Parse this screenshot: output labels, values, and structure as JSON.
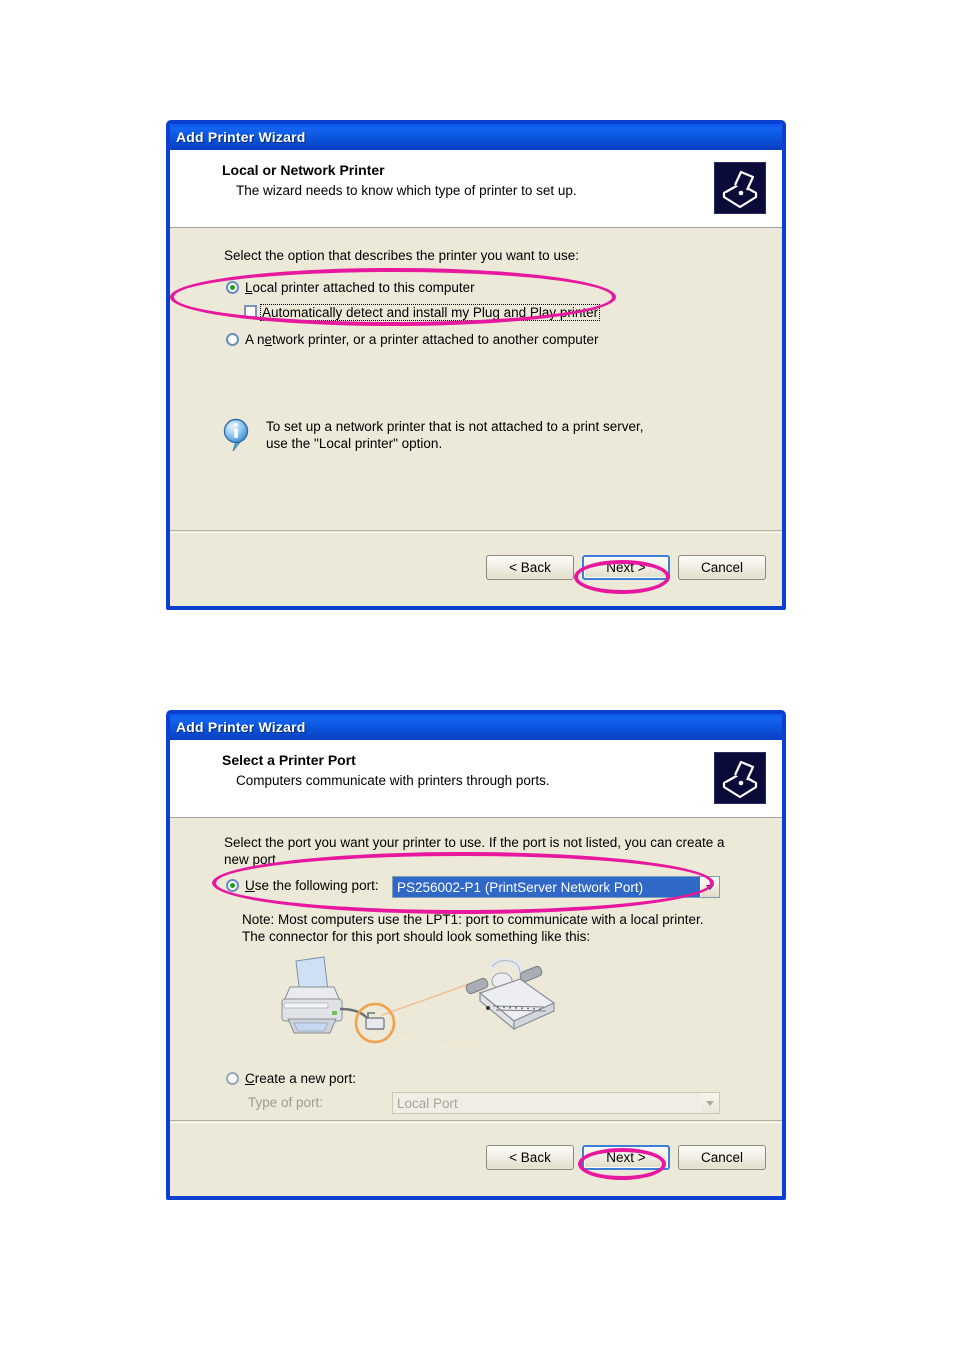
{
  "page": {
    "background": "#ffffff",
    "highlight_color": "#e8189e"
  },
  "dialogs": [
    {
      "id": "local-or-network-printer",
      "titlebar": "Add Printer Wizard",
      "header": {
        "title": "Local or Network Printer",
        "subtitle": "The wizard needs to know which type of printer to set up.",
        "icon": "printer-icon"
      },
      "body": {
        "instruction": "Select the option that describes the printer you want to use:",
        "radio_local": {
          "label": "Local printer attached to this computer",
          "accelerator": "L",
          "checked": true
        },
        "checkbox_autodetect": {
          "label": "Automatically detect and install my Plug and Play printer",
          "accelerator": "A",
          "checked": false
        },
        "radio_network": {
          "label": "A network printer, or a printer attached to another computer",
          "accelerator": "e",
          "checked": false
        },
        "info": {
          "icon": "info-icon",
          "line1": "To set up a network printer that is not attached to a print server,",
          "line2": "use the \"Local printer\" option."
        }
      },
      "buttons": {
        "back": "< Back",
        "next": "Next >",
        "cancel": "Cancel",
        "default": "next"
      }
    },
    {
      "id": "select-a-printer-port",
      "titlebar": "Add Printer Wizard",
      "header": {
        "title": "Select a Printer Port",
        "subtitle": "Computers communicate with printers through ports.",
        "icon": "printer-icon"
      },
      "body": {
        "instruction_line1": "Select the port you want your printer to use.  If the port is not listed, you can create a",
        "instruction_line2": "new port.",
        "radio_use_port": {
          "label": "Use the following port:",
          "accelerator": "U",
          "checked": true
        },
        "port_combo": {
          "value": "PS256002-P1 (PrintServer Network Port)",
          "selected_highlight": "#3068c8",
          "enabled": true
        },
        "note_line1": "Note: Most computers use the LPT1: port to communicate with a local printer.",
        "note_line2": "The connector for this port should look something like this:",
        "illustration": "printer-and-parallel-connector-illustration",
        "radio_create_port": {
          "label": "Create a new port:",
          "accelerator": "C",
          "checked": false
        },
        "type_of_port_label": "Type of port:",
        "type_combo": {
          "value": "Local Port",
          "enabled": false
        }
      },
      "buttons": {
        "back": "< Back",
        "next": "Next >",
        "cancel": "Cancel",
        "default": "next"
      }
    }
  ]
}
